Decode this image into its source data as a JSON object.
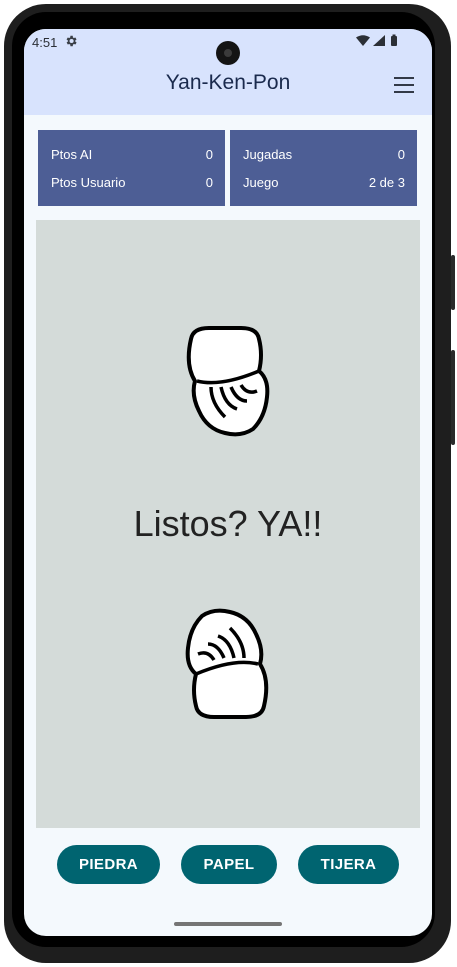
{
  "status": {
    "time": "4:51"
  },
  "appbar": {
    "title": "Yan-Ken-Pon"
  },
  "scores": {
    "ai_label": "Ptos AI",
    "ai_value": "0",
    "user_label": "Ptos Usuario",
    "user_value": "0",
    "plays_label": "Jugadas",
    "plays_value": "0",
    "game_label": "Juego",
    "game_value": "2 de 3"
  },
  "arena": {
    "message": "Listos? YA!!"
  },
  "actions": {
    "rock": "PIEDRA",
    "paper": "PAPEL",
    "scissors": "TIJERA"
  },
  "colors": {
    "appbar": "#d8e3fd",
    "score_panel": "#4d5e95",
    "arena": "#d4dbd9",
    "button": "#006470"
  }
}
